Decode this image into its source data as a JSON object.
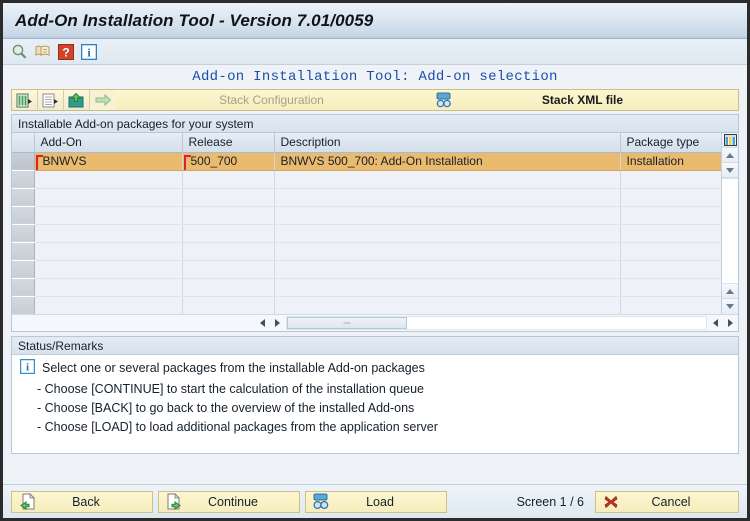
{
  "window": {
    "title": "Add-On Installation Tool - Version 7.01/0059"
  },
  "icon_toolbar": {
    "items": [
      {
        "name": "search-icon",
        "tooltip": "Search"
      },
      {
        "name": "scroll-list-icon",
        "tooltip": "List"
      },
      {
        "name": "help-icon",
        "glyph": "?",
        "tooltip": "Help"
      },
      {
        "name": "info-icon",
        "glyph": "i",
        "tooltip": "Information"
      }
    ]
  },
  "page": {
    "heading": "Add-on Installation Tool: Add-on selection"
  },
  "stack_bar": {
    "icon_buttons": [
      {
        "name": "list-detail-icon",
        "enabled": true
      },
      {
        "name": "list-plain-icon",
        "enabled": true
      },
      {
        "name": "import-upload-icon",
        "enabled": true
      },
      {
        "name": "green-arrow-icon",
        "enabled": false
      }
    ],
    "segments": [
      {
        "label": "Stack Configuration",
        "icon": "green-arrow-icon",
        "enabled": false,
        "active": false
      },
      {
        "label": "Stack XML file",
        "icon": "xml-file-icon",
        "enabled": true,
        "active": true
      }
    ]
  },
  "table_section": {
    "label": "Installable Add-on packages for your system",
    "columns": [
      "Add-On",
      "Release",
      "Description",
      "Package type"
    ],
    "rows": [
      {
        "selected": true,
        "add_on": "BNWVS",
        "release": "500_700",
        "description": "BNWVS 500_700: Add-On Installation",
        "package_type": "Installation"
      },
      {
        "selected": false,
        "add_on": "",
        "release": "",
        "description": "",
        "package_type": ""
      },
      {
        "selected": false,
        "add_on": "",
        "release": "",
        "description": "",
        "package_type": ""
      },
      {
        "selected": false,
        "add_on": "",
        "release": "",
        "description": "",
        "package_type": ""
      },
      {
        "selected": false,
        "add_on": "",
        "release": "",
        "description": "",
        "package_type": ""
      },
      {
        "selected": false,
        "add_on": "",
        "release": "",
        "description": "",
        "package_type": ""
      },
      {
        "selected": false,
        "add_on": "",
        "release": "",
        "description": "",
        "package_type": ""
      },
      {
        "selected": false,
        "add_on": "",
        "release": "",
        "description": "",
        "package_type": ""
      },
      {
        "selected": false,
        "add_on": "",
        "release": "",
        "description": "",
        "package_type": ""
      },
      {
        "selected": false,
        "add_on": "",
        "release": "",
        "description": "",
        "package_type": ""
      }
    ],
    "column_config_icon": "table-settings-icon"
  },
  "status": {
    "header": "Status/Remarks",
    "icon": "info-icon",
    "lines": [
      "Select one or several packages from the installable Add-on packages",
      "- Choose [CONTINUE] to start the calculation of the installation queue",
      "- Choose [BACK] to go back to the overview of the installed Add-ons",
      "- Choose [LOAD] to load additional packages from the application server"
    ]
  },
  "bottom_bar": {
    "back_label": "Back",
    "continue_label": "Continue",
    "load_label": "Load",
    "screen_counter": "Screen 1 / 6",
    "cancel_label": "Cancel"
  },
  "colors": {
    "title_text": "#101418",
    "heading_blue": "#1b4fa8",
    "selected_row": "#eaba6e",
    "button_yellow": "#f6edbe",
    "required_marker_red": "#e02020",
    "cancel_x_red": "#cc3322",
    "window_bg": "#eef2f7"
  }
}
